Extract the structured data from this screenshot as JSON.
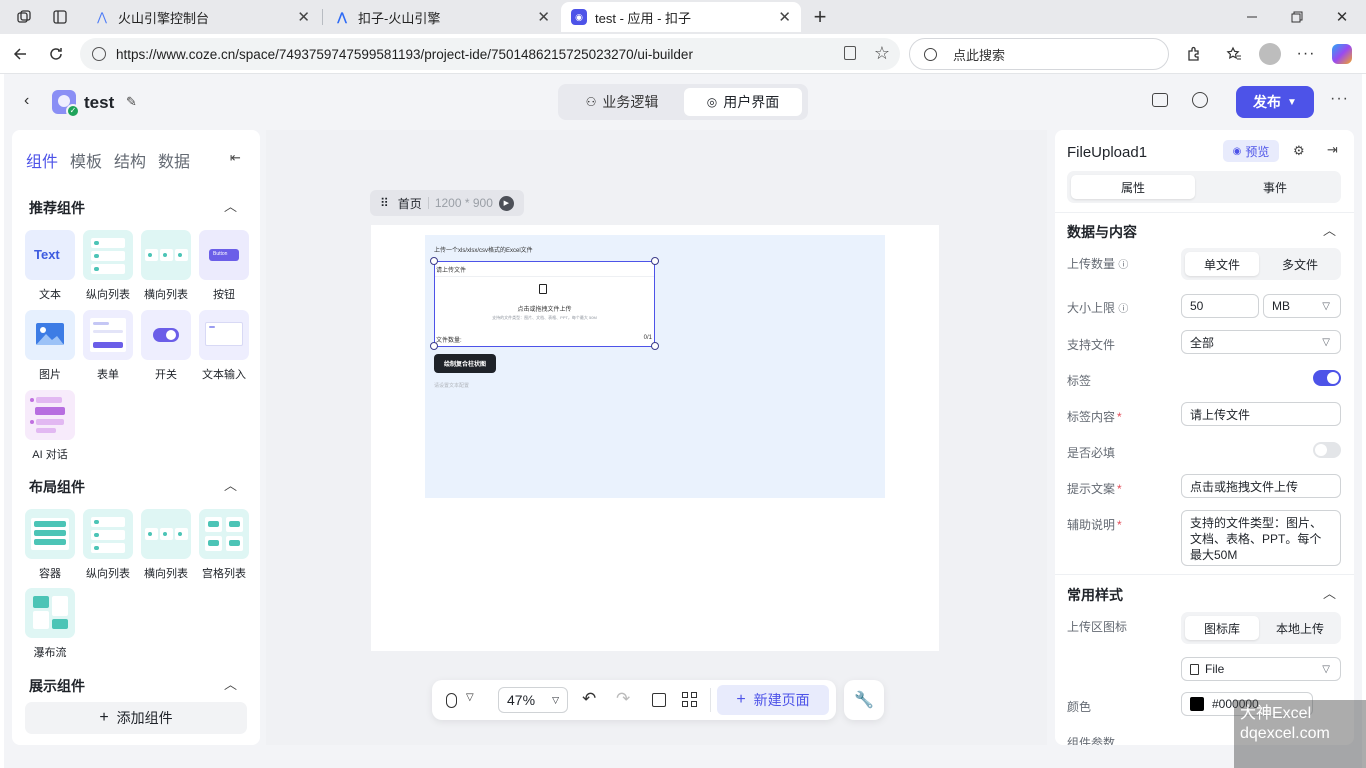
{
  "browser": {
    "tabs": [
      {
        "title": "火山引擎控制台"
      },
      {
        "title": "扣子-火山引擎"
      },
      {
        "title": "test - 应用 - 扣子"
      }
    ],
    "url": "https://www.coze.cn/space/7493759747599581193/project-ide/7501486215725023270/ui-builder",
    "search_placeholder": "点此搜索"
  },
  "header": {
    "project_name": "test",
    "mode_tabs": [
      "业务逻辑",
      "用户界面"
    ],
    "publish_label": "发布"
  },
  "left_panel": {
    "tabs": [
      "组件",
      "模板",
      "结构",
      "数据"
    ],
    "recommended": {
      "title": "推荐组件",
      "items": [
        "文本",
        "纵向列表",
        "横向列表",
        "按钮",
        "图片",
        "表单",
        "开关",
        "文本输入",
        "AI 对话"
      ]
    },
    "layout": {
      "title": "布局组件",
      "items": [
        "容器",
        "纵向列表",
        "横向列表",
        "宫格列表",
        "瀑布流"
      ]
    },
    "display": {
      "title": "展示组件"
    },
    "add_component": "添加组件",
    "thumb_text": "Text",
    "thumb_button": "Button"
  },
  "canvas": {
    "page_name": "首页",
    "page_size": "1200 * 900",
    "hint_text": "上传一个xls/xlsx/csv格式的Excel文件",
    "upload_label": "请上传文件",
    "upload_tip": "点击或拖拽文件上传",
    "upload_desc": "支持的文件类型：图片、文档、表格、PPT，每个最大 50M",
    "file_count_label": "文件数量:",
    "file_count": "0/1",
    "button_label": "绘制复合柱状图",
    "placeholder_text": "请设置文本配置"
  },
  "toolbar": {
    "zoom": "47%",
    "new_page": "新建页面"
  },
  "right_panel": {
    "component_name": "FileUpload1",
    "preview": "预览",
    "tabs": [
      "属性",
      "事件"
    ],
    "data_section": "数据与内容",
    "upload_count_label": "上传数量",
    "upload_count_options": [
      "单文件",
      "多文件"
    ],
    "size_limit_label": "大小上限",
    "size_limit_value": "50",
    "size_unit": "MB",
    "file_types_label": "支持文件",
    "file_types_value": "全部",
    "label_label": "标签",
    "label_content_label": "标签内容",
    "label_content_value": "请上传文件",
    "required_label": "是否必填",
    "hint_label": "提示文案",
    "hint_value": "点击或拖拽文件上传",
    "desc_label": "辅助说明",
    "desc_value": "支持的文件类型：图片、文档、表格、PPT。每个最大50M",
    "style_section": "常用样式",
    "upload_icon_label": "上传区图标",
    "upload_icon_options": [
      "图标库",
      "本地上传"
    ],
    "icon_value": "File",
    "color_label": "颜色",
    "color_value": "#000000",
    "partial_label": "组件参数"
  },
  "watermark": {
    "line1": "大神Excel",
    "line2": "dqexcel.com"
  },
  "colors": {
    "accent": "#4d53e8",
    "canvas_area": "#eaf2fd",
    "thumb_bg": "#dff6f4"
  }
}
